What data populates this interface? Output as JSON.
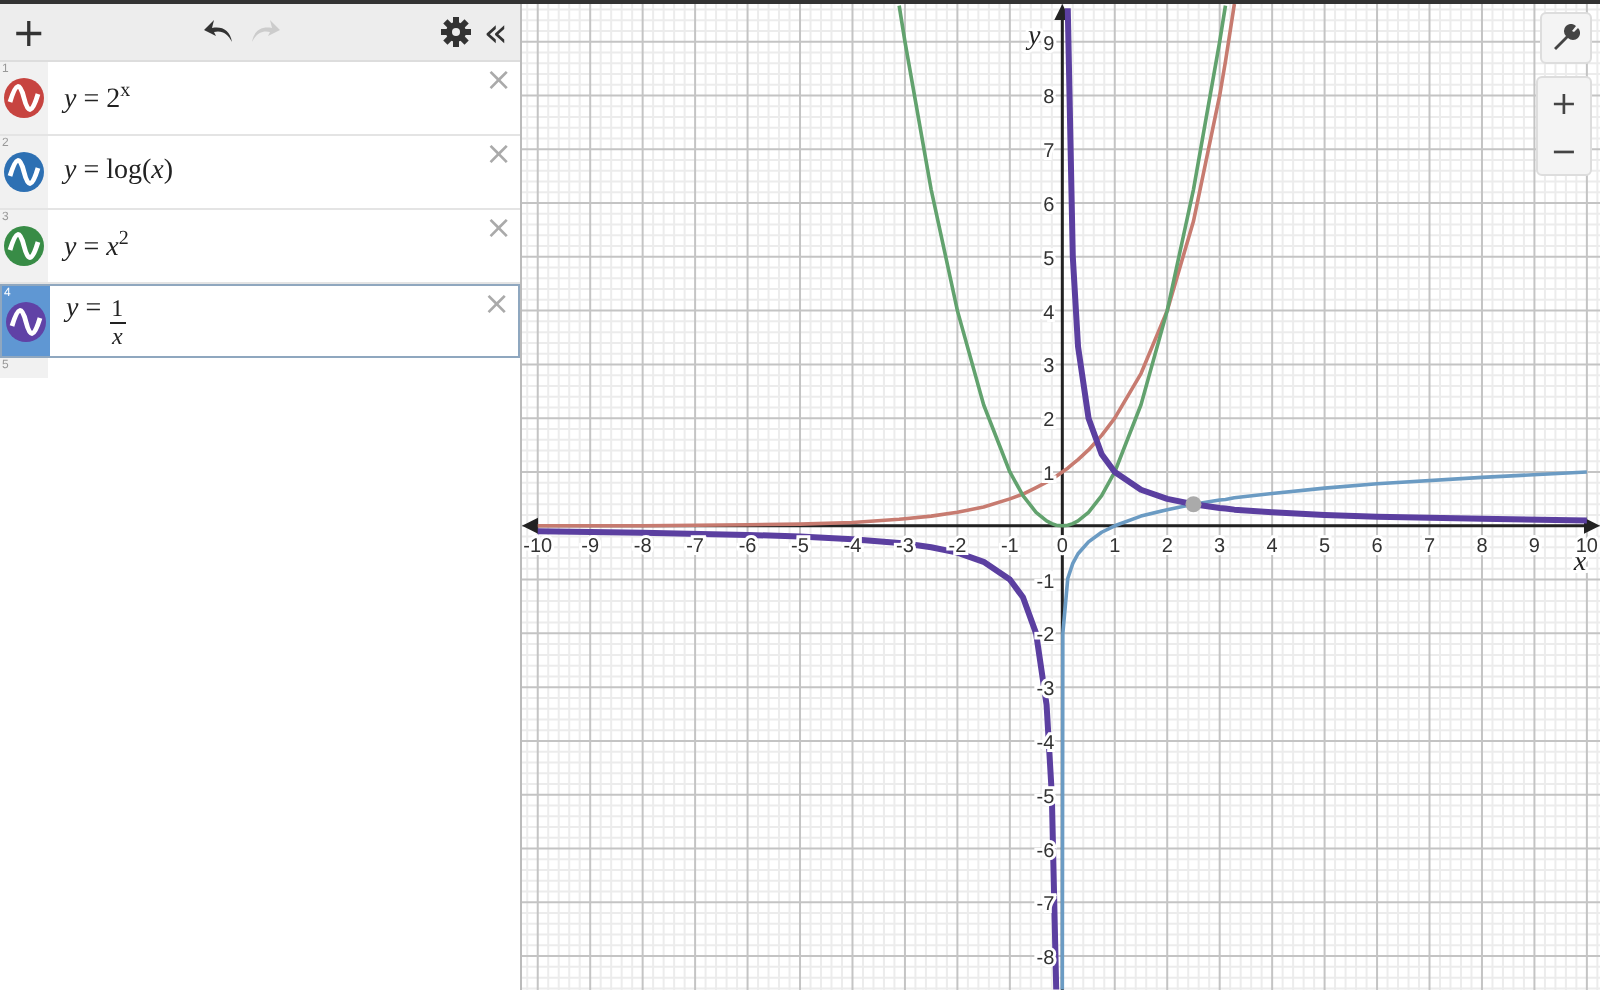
{
  "toolbar": {
    "add": "+",
    "undo": {
      "disabled": false
    },
    "redo": {
      "disabled": true
    },
    "collapse": "«"
  },
  "expressions": [
    {
      "index": "1",
      "kind": "text",
      "text": "*y* = 2$^{x}$",
      "color": "#c74440",
      "selected": false,
      "close": "×"
    },
    {
      "index": "2",
      "kind": "text",
      "text": "*y* = log(*x*)",
      "color": "#2d70b3",
      "selected": false,
      "close": "×"
    },
    {
      "index": "3",
      "kind": "text",
      "text": "*y* = *x*$^{2}$",
      "color": "#388c46",
      "selected": false,
      "close": "×"
    },
    {
      "index": "4",
      "kind": "fraction",
      "lhs": "*y* =",
      "numerator": "1",
      "denominator": "*x*",
      "color": "#6042a6",
      "selected": true,
      "close": "×"
    }
  ],
  "empty_row": {
    "index": "5"
  },
  "graph": {
    "zoom_in": "+",
    "zoom_out": "−",
    "intersection_point": {
      "shown": true
    },
    "chart_data": {
      "type": "line",
      "grid": true,
      "xlabel": "x",
      "ylabel": "y",
      "xlim": [
        -10.3,
        10.25
      ],
      "ylim": [
        -8.63,
        9.7
      ],
      "xticks": [
        -10,
        -9,
        -8,
        -7,
        -6,
        -5,
        -4,
        -3,
        -2,
        -1,
        0,
        1,
        2,
        3,
        4,
        5,
        6,
        7,
        8,
        9,
        10
      ],
      "yticks": [
        -8,
        -7,
        -6,
        -5,
        -4,
        -3,
        -2,
        -1,
        1,
        2,
        3,
        4,
        5,
        6,
        7,
        8,
        9
      ],
      "x": [
        -10,
        -8,
        -6,
        -5,
        -4,
        -3.11,
        -3,
        -2.5,
        -2,
        -1.5,
        -1,
        -0.75,
        -0.5,
        -0.3,
        -0.2,
        -0.116,
        0,
        2.4e-09,
        0.01,
        0.104,
        0.2,
        0.3,
        0.5,
        0.75,
        1,
        1.5,
        2,
        2.5,
        3,
        3.11,
        3.28,
        4,
        5,
        6,
        8,
        10
      ],
      "series": [
        {
          "color": "#c77b70",
          "values": [
            0,
            0,
            0.02,
            0.03,
            0.06,
            0.12,
            0.13,
            0.18,
            0.25,
            0.35,
            0.5,
            0.59,
            0.71,
            0.81,
            0.87,
            0.92,
            1,
            1,
            1.01,
            1.07,
            1.15,
            1.23,
            1.41,
            1.68,
            2,
            2.83,
            4,
            5.66,
            8,
            8.63,
            9.7,
            null,
            null,
            null,
            null,
            null
          ]
        },
        {
          "color": "#6b9bc3",
          "values": [
            null,
            null,
            null,
            null,
            null,
            null,
            null,
            null,
            null,
            null,
            null,
            null,
            null,
            null,
            null,
            null,
            null,
            -8.62,
            -2,
            -0.98,
            -0.7,
            -0.52,
            -0.3,
            -0.12,
            0,
            0.18,
            0.3,
            0.4,
            0.48,
            0.49,
            0.52,
            0.6,
            0.7,
            0.78,
            0.9,
            1
          ]
        },
        {
          "color": "#62a26e",
          "values": [
            null,
            null,
            null,
            null,
            null,
            9.67,
            9,
            6.25,
            4,
            2.25,
            1,
            0.56,
            0.25,
            0.09,
            0.04,
            0.01,
            0,
            0,
            0,
            0.01,
            0.04,
            0.09,
            0.25,
            0.56,
            1,
            2.25,
            4,
            6.25,
            9,
            9.67,
            null,
            null,
            null,
            null,
            null,
            null
          ]
        },
        {
          "color": "#5b3fa0",
          "values": [
            -0.1,
            -0.13,
            -0.17,
            -0.2,
            -0.25,
            -0.32,
            -0.33,
            -0.4,
            -0.5,
            -0.67,
            -1,
            -1.33,
            -2,
            -3.33,
            -5,
            -8.62,
            null,
            null,
            null,
            9.62,
            5,
            3.33,
            2,
            1.33,
            1,
            0.67,
            0.5,
            0.4,
            0.33,
            0.32,
            0.3,
            0.25,
            0.2,
            0.17,
            0.13,
            0.1
          ]
        }
      ]
    }
  }
}
